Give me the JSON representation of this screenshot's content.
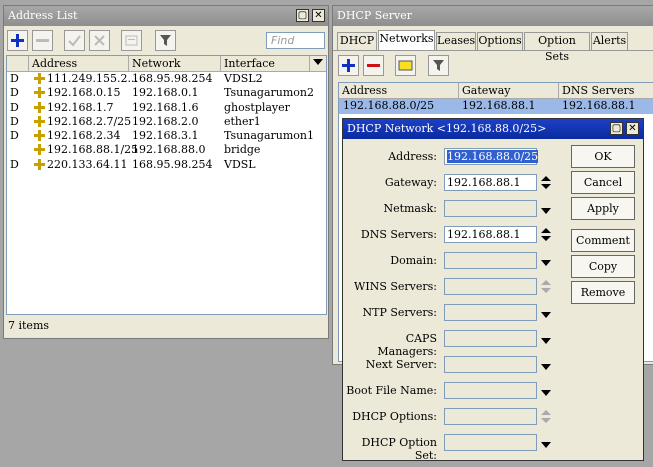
{
  "address_list": {
    "title": "Address List",
    "find_placeholder": "Find",
    "columns": [
      "Address",
      "Network",
      "Interface"
    ],
    "rows": [
      {
        "flag": "D",
        "address": "111.249.155.2...",
        "network": "168.95.98.254",
        "interface": "VDSL2"
      },
      {
        "flag": "D",
        "address": "192.168.0.15",
        "network": "192.168.0.1",
        "interface": "Tsunagarumon2"
      },
      {
        "flag": "D",
        "address": "192.168.1.7",
        "network": "192.168.1.6",
        "interface": "ghostplayer"
      },
      {
        "flag": "D",
        "address": "192.168.2.7/25",
        "network": "192.168.2.0",
        "interface": "ether1"
      },
      {
        "flag": "D",
        "address": "192.168.2.34",
        "network": "192.168.3.1",
        "interface": "Tsunagarumon1"
      },
      {
        "flag": "",
        "address": "192.168.88.1/25",
        "network": "192.168.88.0",
        "interface": "bridge"
      },
      {
        "flag": "D",
        "address": "220.133.64.11",
        "network": "168.95.98.254",
        "interface": "VDSL"
      }
    ],
    "status": "7 items"
  },
  "dhcp_server": {
    "title": "DHCP Server",
    "tabs": [
      "DHCP",
      "Networks",
      "Leases",
      "Options",
      "Option Sets",
      "Alerts"
    ],
    "active_tab": "Networks",
    "columns": [
      "Address",
      "Gateway",
      "DNS Servers"
    ],
    "rows": [
      {
        "address": "192.168.88.0/25",
        "gateway": "192.168.88.1",
        "dns": "192.168.88.1"
      }
    ]
  },
  "dhcp_network": {
    "title": "DHCP Network <192.168.88.0/25>",
    "fields": [
      {
        "label": "Address:",
        "value": "192.168.88.0/25"
      },
      {
        "label": "Gateway:",
        "value": "192.168.88.1"
      },
      {
        "label": "Netmask:",
        "value": ""
      },
      {
        "label": "DNS Servers:",
        "value": "192.168.88.1"
      },
      {
        "label": "Domain:",
        "value": ""
      },
      {
        "label": "WINS Servers:",
        "value": ""
      },
      {
        "label": "NTP Servers:",
        "value": ""
      },
      {
        "label": "CAPS Managers:",
        "value": ""
      },
      {
        "label": "Next Server:",
        "value": ""
      },
      {
        "label": "Boot File Name:",
        "value": ""
      },
      {
        "label": "DHCP Options:",
        "value": ""
      },
      {
        "label": "DHCP Option Set:",
        "value": ""
      }
    ],
    "buttons": {
      "ok": "OK",
      "cancel": "Cancel",
      "apply": "Apply",
      "comment": "Comment",
      "copy": "Copy",
      "remove": "Remove"
    }
  },
  "colors": {
    "accent": "#0a2a9e",
    "selection": "#9ab8e8",
    "add": "#1030c0",
    "remove": "#d01010"
  }
}
